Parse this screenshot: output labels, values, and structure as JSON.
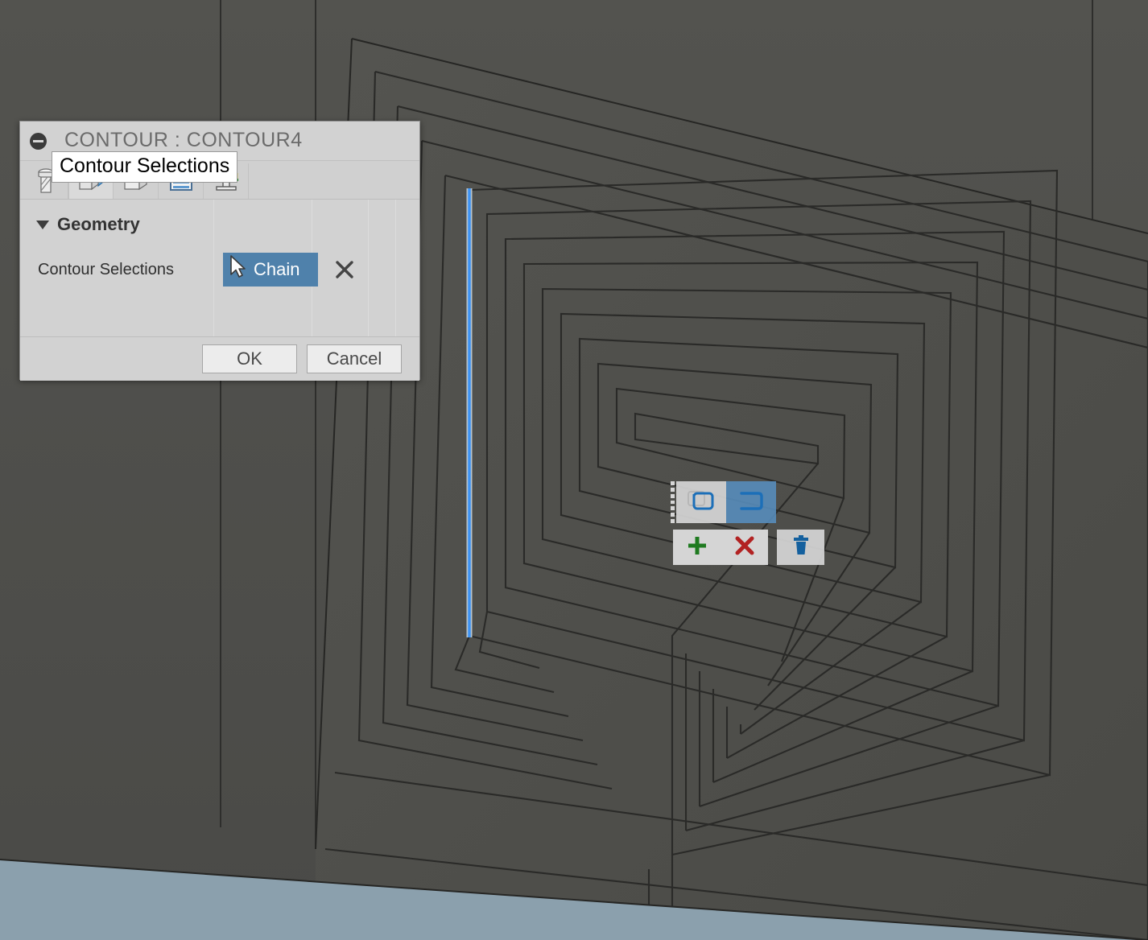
{
  "app": {
    "viewport_bg": "#4a4a47",
    "selected_edge_color": "#3d93f5",
    "floor_color": "#8ba0ad"
  },
  "dialog": {
    "title": "CONTOUR : CONTOUR4",
    "collapse_icon": "minus-circle-icon",
    "tabs": [
      {
        "name": "tool",
        "icon": "endmill-tool-icon",
        "active": false
      },
      {
        "name": "geometry",
        "icon": "geometry-cube-icon",
        "active": true
      },
      {
        "name": "heights",
        "icon": "heights-cube-icon",
        "active": false
      },
      {
        "name": "passes",
        "icon": "passes-layers-icon",
        "active": false
      },
      {
        "name": "linking",
        "icon": "linking-ramp-icon",
        "active": false
      }
    ],
    "section": {
      "title": "Geometry",
      "expanded": true,
      "disclosure_icon": "triangle-down-icon"
    },
    "field": {
      "label": "Contour Selections",
      "button_label": "Chain",
      "button_icon": "select-cursor-icon",
      "button_color": "#4f81ab",
      "clear_icon": "close-x-icon"
    },
    "footer": {
      "ok_label": "OK",
      "cancel_label": "Cancel"
    }
  },
  "tooltip": {
    "text": "Contour Selections"
  },
  "mini_toolbar": {
    "drag_handle_icon": "drag-dots-icon",
    "mode_buttons": [
      {
        "name": "closed-chain",
        "icon": "closed-loop-icon",
        "selected": false
      },
      {
        "name": "open-chain",
        "icon": "open-chain-icon",
        "selected": true
      }
    ],
    "action_buttons": [
      {
        "name": "add-selection",
        "icon": "plus-icon",
        "color": "#1f7a20"
      },
      {
        "name": "remove-selection",
        "icon": "red-x-icon",
        "color": "#b22222"
      },
      {
        "name": "delete-selection",
        "icon": "trash-icon",
        "color": "#14609e"
      }
    ]
  }
}
